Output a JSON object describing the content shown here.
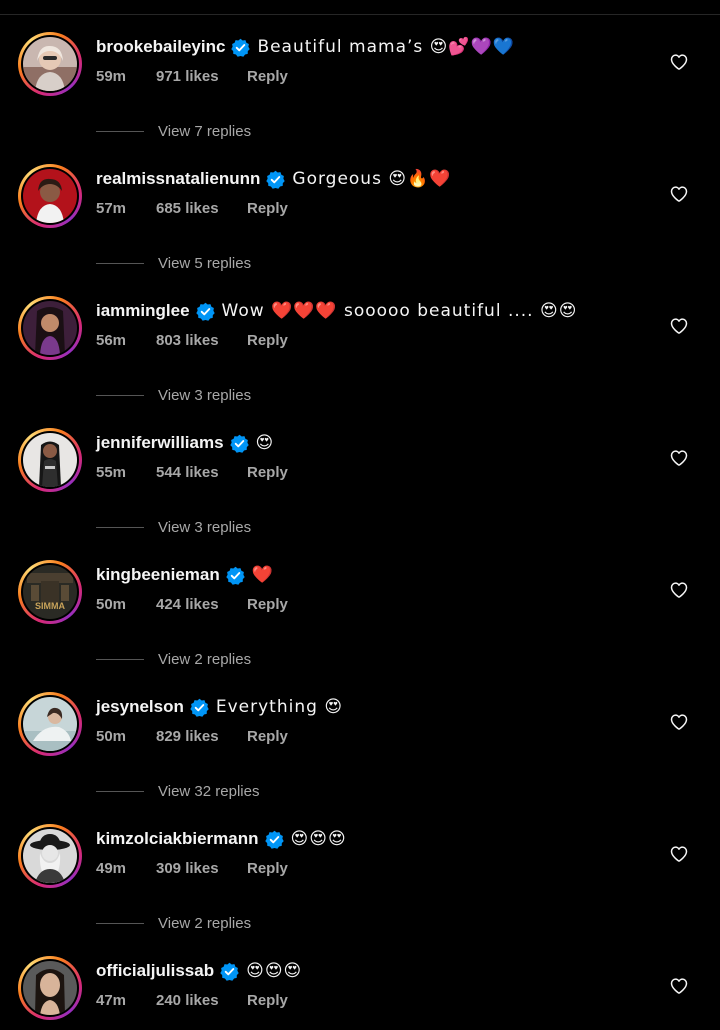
{
  "colors": {
    "background": "#000000",
    "text_primary": "#f5f5f5",
    "text_secondary": "#a8a8a8",
    "verified_badge": "#0095f6",
    "story_ring": [
      "#d62976",
      "#fa7e1e",
      "#feda75",
      "#962fbf"
    ]
  },
  "comments": [
    {
      "username": "brookebaileyinc",
      "verified": true,
      "text": "Beautiful mama’s 😍💕💜💙",
      "time": "59m",
      "likes": "971 likes",
      "reply_label": "Reply",
      "view_replies": "View 7 replies"
    },
    {
      "username": "realmissnatalienunn",
      "verified": true,
      "text": "Gorgeous 😍🔥❤️",
      "time": "57m",
      "likes": "685 likes",
      "reply_label": "Reply",
      "view_replies": "View 5 replies"
    },
    {
      "username": "iamminglee",
      "verified": true,
      "text": "Wow ❤️❤️❤️ sooooo beautiful .... 😍😍",
      "time": "56m",
      "likes": "803 likes",
      "reply_label": "Reply",
      "view_replies": "View 3 replies"
    },
    {
      "username": "jenniferwilliams",
      "verified": true,
      "text": "😍",
      "time": "55m",
      "likes": "544 likes",
      "reply_label": "Reply",
      "view_replies": "View 3 replies"
    },
    {
      "username": "kingbeenieman",
      "verified": true,
      "text": "❤️",
      "time": "50m",
      "likes": "424 likes",
      "reply_label": "Reply",
      "view_replies": "View 2 replies",
      "avatar_logo_text": "SIMMA"
    },
    {
      "username": "jesynelson",
      "verified": true,
      "text": "Everything 😍",
      "time": "50m",
      "likes": "829 likes",
      "reply_label": "Reply",
      "view_replies": "View 32 replies"
    },
    {
      "username": "kimzolciakbiermann",
      "verified": true,
      "text": "😍😍😍",
      "time": "49m",
      "likes": "309 likes",
      "reply_label": "Reply",
      "view_replies": "View 2 replies"
    },
    {
      "username": "officialjulissab",
      "verified": true,
      "text": "😍😍😍",
      "time": "47m",
      "likes": "240 likes",
      "reply_label": "Reply"
    }
  ],
  "icons": {
    "verified": "verified-badge-icon",
    "like": "heart-outline-icon"
  }
}
